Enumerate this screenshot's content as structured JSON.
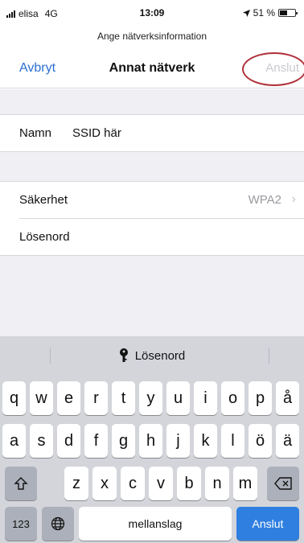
{
  "status": {
    "carrier": "elisa",
    "network": "4G",
    "time": "13:09",
    "battery": "51 %",
    "battery_level": 0.51
  },
  "header": {
    "subtitle": "Ange nätverksinformation",
    "cancel": "Avbryt",
    "title": "Annat nätverk",
    "join": "Anslut"
  },
  "form": {
    "name_label": "Namn",
    "name_value": "SSID här",
    "security_label": "Säkerhet",
    "security_value": "WPA2",
    "password_label": "Lösenord"
  },
  "keyboard": {
    "hint": "Lösenord",
    "row1": [
      "q",
      "w",
      "e",
      "r",
      "t",
      "y",
      "u",
      "i",
      "o",
      "p",
      "å"
    ],
    "row2": [
      "a",
      "s",
      "d",
      "f",
      "g",
      "h",
      "j",
      "k",
      "l",
      "ö",
      "ä"
    ],
    "row3": [
      "z",
      "x",
      "c",
      "v",
      "b",
      "n",
      "m"
    ],
    "numbers": "123",
    "space": "mellanslag",
    "return": "Anslut"
  },
  "icons": {
    "key": "key-icon",
    "globe": "globe-icon",
    "shift": "shift-icon",
    "delete": "delete-icon",
    "location": "location-arrow-icon",
    "chevron": "chevron-right-icon"
  }
}
